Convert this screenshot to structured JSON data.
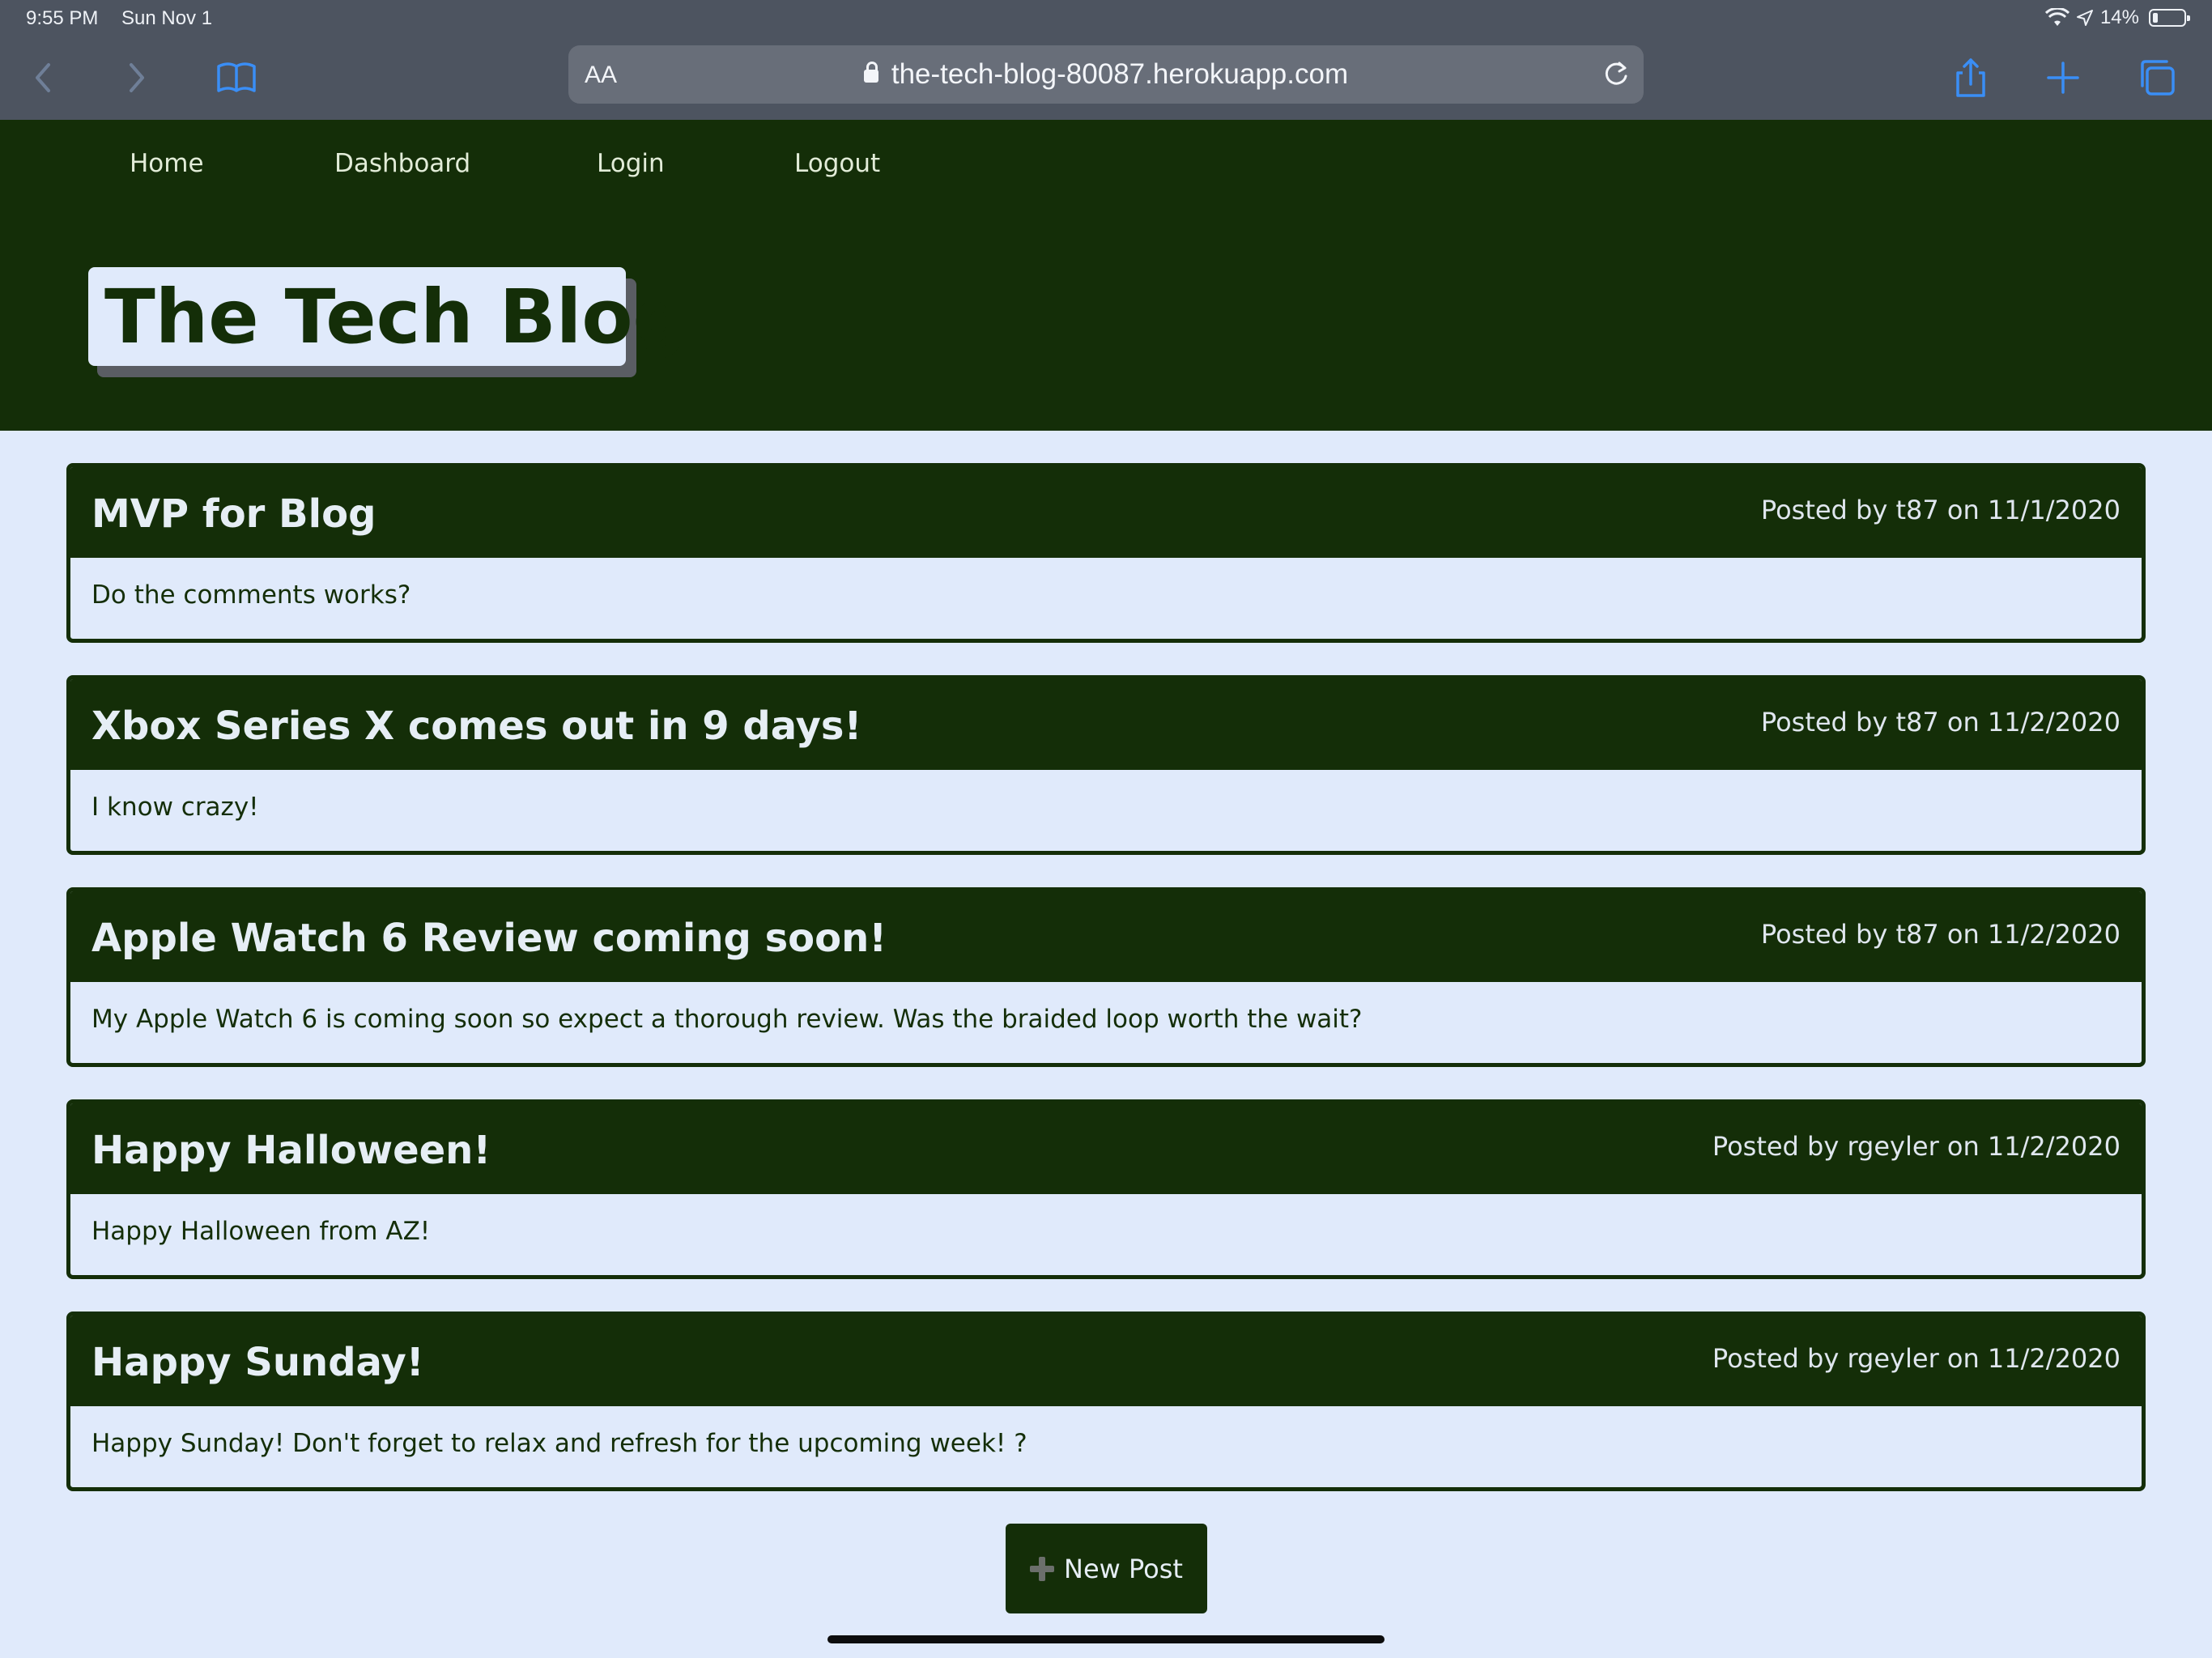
{
  "status": {
    "time": "9:55 PM",
    "date": "Sun Nov 1",
    "battery": "14%",
    "icons": [
      "wifi-icon",
      "location-icon",
      "battery-icon"
    ]
  },
  "browser": {
    "text_size": "AA",
    "url": "the-tech-blog-80087.herokuapp.com",
    "icons": [
      "back-icon",
      "forward-icon",
      "bookmarks-icon",
      "lock-icon",
      "reload-icon",
      "share-icon",
      "new-tab-icon",
      "tabs-icon"
    ],
    "accent": "#3a8ef6"
  },
  "nav": {
    "home": "Home",
    "dashboard": "Dashboard",
    "login": "Login",
    "logout": "Logout"
  },
  "site": {
    "title": "The Tech Blog",
    "colors": {
      "primary": "#142e08",
      "background": "#e0eafb"
    }
  },
  "posts": [
    {
      "title": "MVP for Blog",
      "meta": "Posted by t87 on 11/1/2020",
      "body": "Do the comments works?"
    },
    {
      "title": "Xbox Series X comes out in 9 days!",
      "meta": "Posted by t87 on 11/2/2020",
      "body": "I know crazy!"
    },
    {
      "title": "Apple Watch 6 Review coming soon!",
      "meta": "Posted by t87 on 11/2/2020",
      "body": "My Apple Watch 6 is coming soon so expect a thorough review. Was the braided loop worth the wait?"
    },
    {
      "title": "Happy Halloween!",
      "meta": "Posted by rgeyler on 11/2/2020",
      "body": "Happy Halloween from AZ!"
    },
    {
      "title": "Happy Sunday!",
      "meta": "Posted by rgeyler on 11/2/2020",
      "body": "Happy Sunday! Don't forget to relax and refresh for the upcoming week! ?"
    }
  ],
  "actions": {
    "new_post": "New Post",
    "new_post_icon": "plus-icon"
  }
}
